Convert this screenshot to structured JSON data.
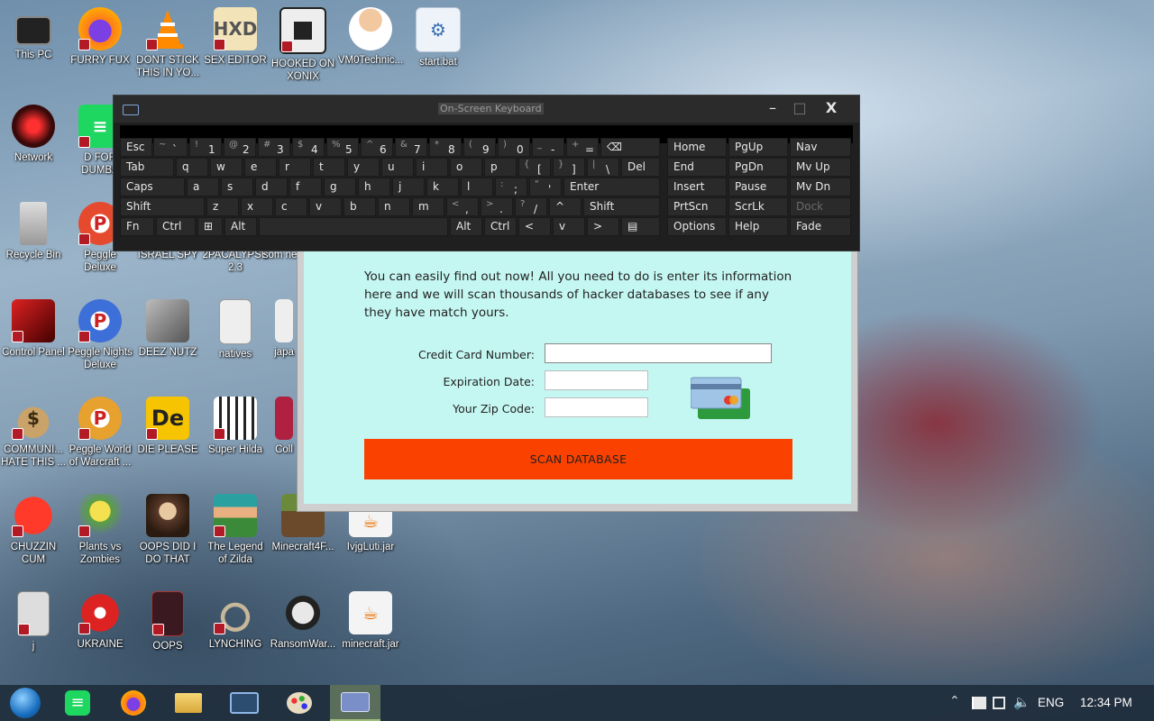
{
  "desktop": {
    "icons": [
      {
        "label": "This PC"
      },
      {
        "label": "FURRY FUX"
      },
      {
        "label": "DONT STICK THIS IN YO..."
      },
      {
        "label": "SEX EDITOR"
      },
      {
        "label": "HOOKED ON XONIX"
      },
      {
        "label": "VM0Technic..."
      },
      {
        "label": "start.bat"
      },
      {
        "label": "Network"
      },
      {
        "label": "D FOR DUMBA"
      },
      {
        "label": "Recycle Bin"
      },
      {
        "label": "Peggle Deluxe"
      },
      {
        "label": "ISRAEL SPY"
      },
      {
        "label": "2PACALYPSE 2.3"
      },
      {
        "label": "som need"
      },
      {
        "label": "Control Panel"
      },
      {
        "label": "Peggle Nights Deluxe"
      },
      {
        "label": "DEEZ NUTZ"
      },
      {
        "label": "natives"
      },
      {
        "label": "japa"
      },
      {
        "label": "COMMUNI... HATE THIS ..."
      },
      {
        "label": "Peggle World of Warcraft ..."
      },
      {
        "label": "DIE PLEASE"
      },
      {
        "label": "Super Hilda"
      },
      {
        "label": "Coll"
      },
      {
        "label": "CHUZZIN CUM"
      },
      {
        "label": "Plants vs Zombies"
      },
      {
        "label": "OOPS DID I DO THAT"
      },
      {
        "label": "The Legend of Zilda"
      },
      {
        "label": "Minecraft4F..."
      },
      {
        "label": "IvjgLuti.jar"
      },
      {
        "label": "j"
      },
      {
        "label": "UKRAINE"
      },
      {
        "label": "OOPS"
      },
      {
        "label": "LYNCHING"
      },
      {
        "label": "RansomWar..."
      },
      {
        "label": "minecraft.jar"
      }
    ]
  },
  "app": {
    "intro": "You can easily find out now! All you need to do is enter its information here and we will scan thousands of hacker databases to see if any they have match yours.",
    "form": {
      "card_label": "Credit Card Number:",
      "card_value": "",
      "expiration_label": "Expiration Date:",
      "expiration_value": "",
      "zip_label": "Your Zip Code:",
      "zip_value": ""
    },
    "scan_button": "SCAN DATABASE"
  },
  "osk": {
    "title": "On-Screen Keyboard",
    "minimize": "–",
    "maximize": "□",
    "close": "X"
  },
  "taskbar": {
    "language": "ENG",
    "time": "12:34 PM"
  }
}
